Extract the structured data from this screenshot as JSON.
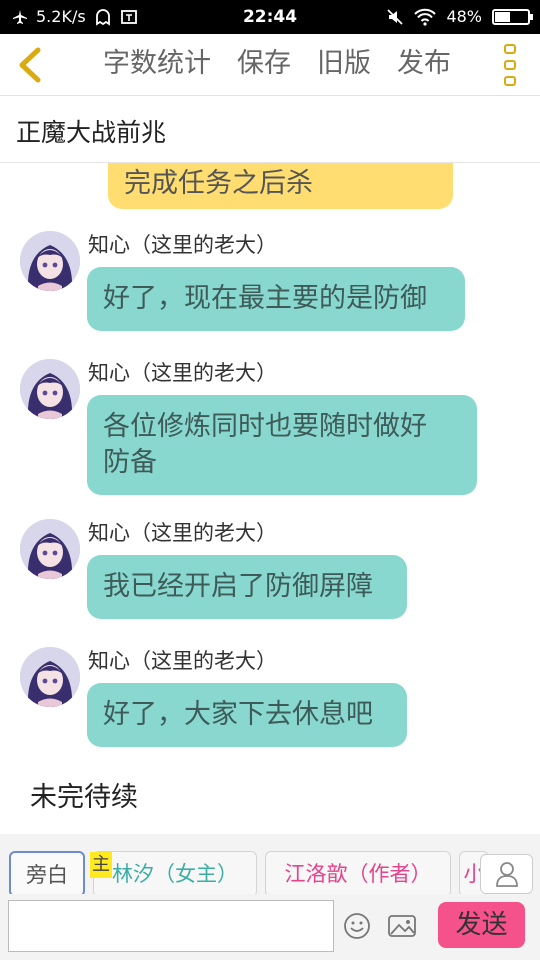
{
  "status_bar": {
    "net_speed": "5.2K/s",
    "time": "22:44",
    "battery": "48%",
    "battery_level": 0.48
  },
  "toolbar": {
    "actions": [
      "字数统计",
      "保存",
      "旧版",
      "发布"
    ]
  },
  "story": {
    "title": "正魔大战前兆"
  },
  "chat": {
    "partial_message": "完成任务之后杀",
    "messages": [
      {
        "sender": "知心（这里的老大）",
        "text": "好了，现在最主要的是防御"
      },
      {
        "sender": "知心（这里的老大）",
        "line1": "各位修炼同时也要随时做好",
        "line2": "防备"
      },
      {
        "sender": "知心（这里的老大）",
        "text": "我已经开启了防御屏障"
      },
      {
        "sender": "知心（这里的老大）",
        "text": "好了，大家下去休息吧"
      }
    ],
    "end_note": "未完待续"
  },
  "roles": {
    "narrator": "旁白",
    "lead_badge": "主",
    "items": [
      "林汐（女主）",
      "江洛歆（作者）",
      "小"
    ]
  },
  "composer": {
    "input_value": "",
    "send_label": "发送"
  },
  "colors": {
    "accent": "#d9aa12",
    "bubble": "#88d8cf",
    "send": "#f5518b",
    "system_bubble": "#ffdd70"
  }
}
